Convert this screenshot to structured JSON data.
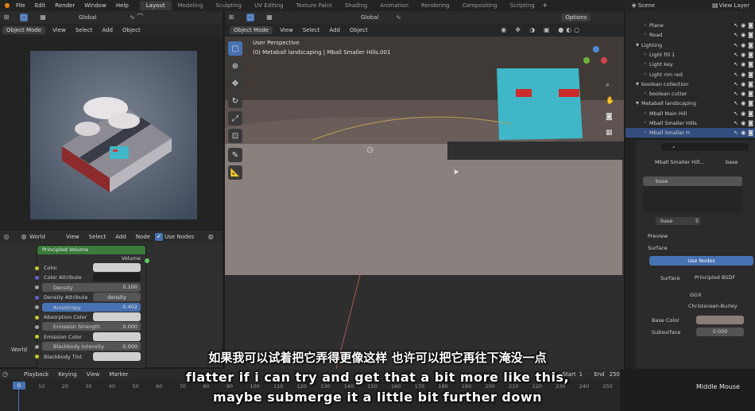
{
  "menu": {
    "items": [
      "File",
      "Edit",
      "Render",
      "Window",
      "Help"
    ]
  },
  "workspace_tabs": [
    "Layout",
    "Modeling",
    "Sculpting",
    "UV Editing",
    "Texture Paint",
    "Shading",
    "Animation",
    "Rendering",
    "Compositing",
    "Scripting"
  ],
  "active_tab": "Layout",
  "scene": {
    "label": "Scene",
    "view_layer": "View Layer"
  },
  "left_header": {
    "transform": "Global",
    "mode": "Object Mode",
    "items": [
      "View",
      "Select",
      "Add",
      "Object"
    ]
  },
  "viewport": {
    "transform": "Global",
    "options": "Options",
    "mode": "Object Mode",
    "items": [
      "View",
      "Select",
      "Add",
      "Object"
    ],
    "perspective": "User Perspective",
    "object_info": "(0) Metaball landscaping | Mball Smaller Hills.001"
  },
  "node_editor": {
    "world": "World",
    "items": [
      "View",
      "Select",
      "Add",
      "Node"
    ],
    "use_nodes": "Use Nodes",
    "node_title": "Principled Volume",
    "output": "Volume",
    "rows": [
      {
        "label": "Color",
        "value": "",
        "color": "#c7c729"
      },
      {
        "label": "Color Attribute",
        "value": "",
        "color": "#6363c7"
      },
      {
        "label": "Density",
        "value": "0.100",
        "color": "#a1a1a1"
      },
      {
        "label": "Density Attribute",
        "value": "density",
        "color": "#6363c7"
      },
      {
        "label": "Anisotropy",
        "value": "0.402",
        "color": "#a1a1a1"
      },
      {
        "label": "Absorption Color",
        "value": "",
        "color": "#c7c729"
      },
      {
        "label": "Emission Strength",
        "value": "0.000",
        "color": "#a1a1a1"
      },
      {
        "label": "Emission Color",
        "value": "",
        "color": "#c7c729"
      },
      {
        "label": "Blackbody Intensity",
        "value": "0.000",
        "color": "#a1a1a1"
      },
      {
        "label": "Blackbody Tint",
        "value": "",
        "color": "#c7c729"
      }
    ],
    "footer": "World"
  },
  "timeline": {
    "items": [
      "Playback",
      "Keying",
      "View",
      "Marker"
    ],
    "start_label": "Start",
    "start": "1",
    "end_label": "End",
    "end": "250",
    "current": "0",
    "ticks": [
      "10",
      "20",
      "30",
      "40",
      "50",
      "60",
      "70",
      "80",
      "90",
      "100",
      "110",
      "120",
      "130",
      "140",
      "150",
      "160",
      "170",
      "180",
      "190",
      "200",
      "210",
      "220",
      "230",
      "240",
      "250"
    ]
  },
  "outliner": [
    {
      "name": "Plane",
      "indent": 1
    },
    {
      "name": "Road",
      "indent": 1
    },
    {
      "name": "Lighting",
      "indent": 0
    },
    {
      "name": "Light fill 1",
      "indent": 1
    },
    {
      "name": "Light key",
      "indent": 1
    },
    {
      "name": "Light rim red",
      "indent": 1
    },
    {
      "name": "boolean collection",
      "indent": 0
    },
    {
      "name": "boolean cutter",
      "indent": 1
    },
    {
      "name": "Metaball landscaping",
      "indent": 0
    },
    {
      "name": "Mball Main Hill",
      "indent": 1
    },
    {
      "name": "Mball Smaller Hills",
      "indent": 1
    },
    {
      "name": "Mball Smaller H",
      "indent": 1
    }
  ],
  "properties": {
    "object": "Mball Smaller Hill...",
    "data": "base",
    "slot": "base",
    "material": "base",
    "users": "5",
    "preview": "Preview",
    "surface_panel": "Surface",
    "use_nodes": "Use Nodes",
    "surface_label": "Surface",
    "surface_value": "Principled BSDF",
    "distribution": "GGX",
    "subsurface_method": "Christensen-Burley",
    "base_color_label": "Base Color",
    "subsurface_label": "Subsurface",
    "subsurface_value": "0.000"
  },
  "subtitles": {
    "chinese": "如果我可以试着把它弄得更像这样 也许可以把它再往下淹没一点",
    "english_1": "flatter if i can try and get that a bit more like  this,",
    "english_2": "maybe submerge it a little bit further down"
  },
  "status": {
    "hint": "Middle Mouse"
  }
}
